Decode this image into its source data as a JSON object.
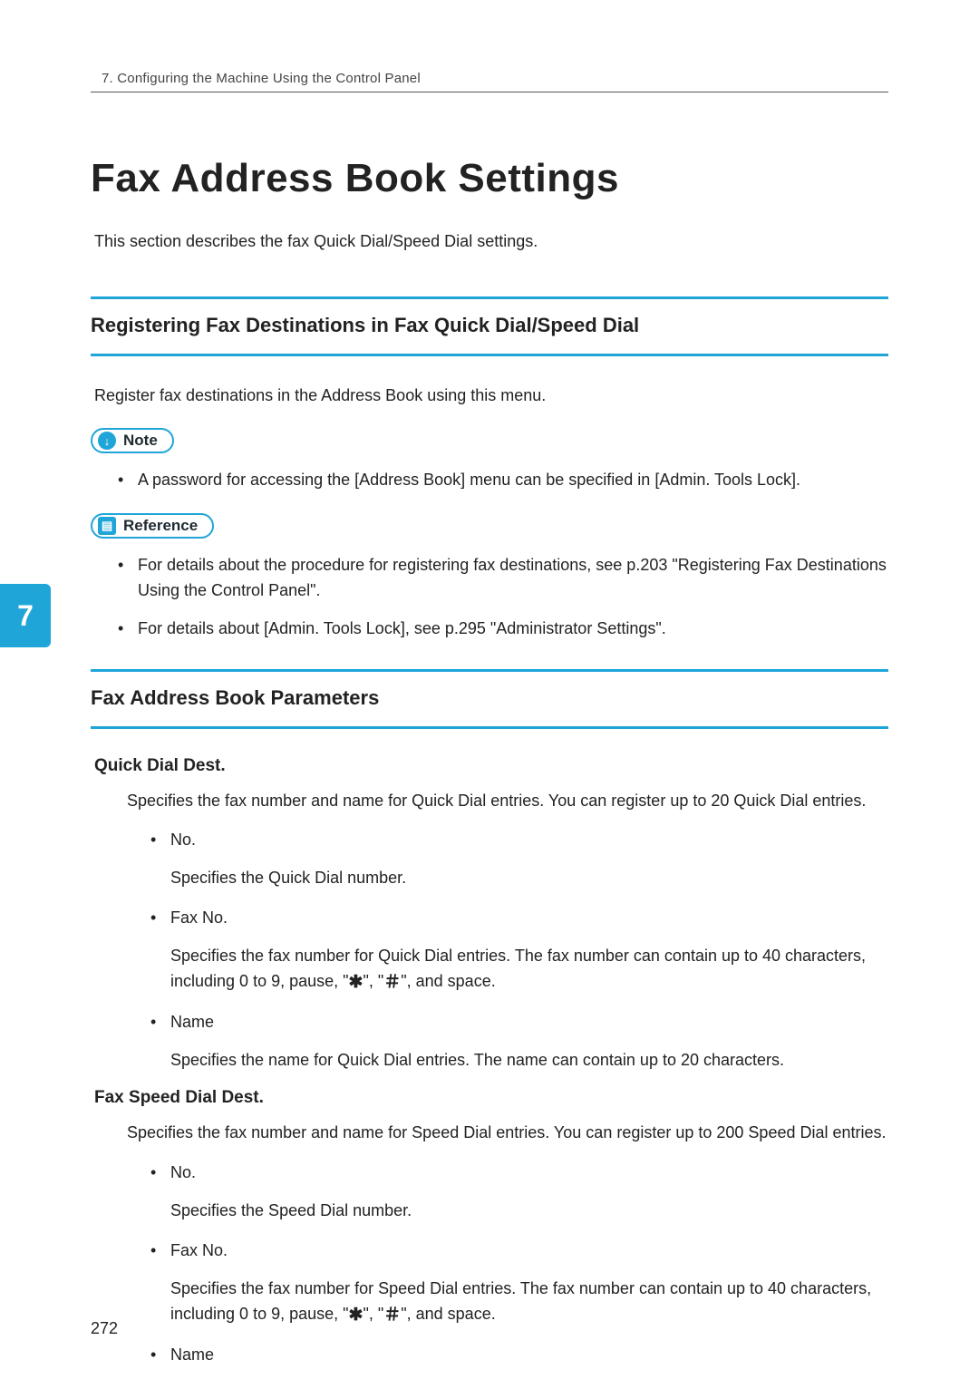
{
  "header": {
    "running_head": "7. Configuring the Machine Using the Control Panel"
  },
  "chapter_tab": "7",
  "page_number": "272",
  "title": "Fax Address Book Settings",
  "intro": "This section describes the fax Quick Dial/Speed Dial settings.",
  "section1": {
    "heading": "Registering Fax Destinations in Fax Quick Dial/Speed Dial",
    "body": "Register fax destinations in the Address Book using this menu.",
    "note_label": "Note",
    "note_items": [
      "A password for accessing the [Address Book] menu can be specified in [Admin. Tools Lock]."
    ],
    "reference_label": "Reference",
    "reference_items": [
      "For details about the procedure for registering fax destinations, see p.203 \"Registering Fax Destinations Using the Control Panel\".",
      "For details about [Admin. Tools Lock], see p.295 \"Administrator Settings\"."
    ]
  },
  "section2": {
    "heading": "Fax Address Book Parameters",
    "quick": {
      "title": "Quick Dial Dest.",
      "desc": "Specifies the fax number and name for Quick Dial entries. You can register up to 20 Quick Dial entries.",
      "items": {
        "no_label": "No.",
        "no_desc": "Specifies the Quick Dial number.",
        "fax_label": "Fax No.",
        "fax_desc_a": "Specifies the fax number for Quick Dial entries. The fax number can contain up to 40 characters, including 0 to 9, pause, \"",
        "fax_desc_b": "\", \"",
        "fax_desc_c": "\", and space.",
        "name_label": "Name",
        "name_desc": "Specifies the name for Quick Dial entries. The name can contain up to 20 characters."
      }
    },
    "speed": {
      "title": "Fax Speed Dial Dest.",
      "desc": "Specifies the fax number and name for Speed Dial entries. You can register up to 200 Speed Dial entries.",
      "items": {
        "no_label": "No.",
        "no_desc": "Specifies the Speed Dial number.",
        "fax_label": "Fax No.",
        "fax_desc_a": "Specifies the fax number for Speed Dial entries. The fax number can contain up to 40 characters, including 0 to 9, pause, \"",
        "fax_desc_b": "\", \"",
        "fax_desc_c": "\", and space.",
        "name_label": "Name"
      }
    }
  },
  "symbols": {
    "star": "✱",
    "hash": "＃"
  }
}
